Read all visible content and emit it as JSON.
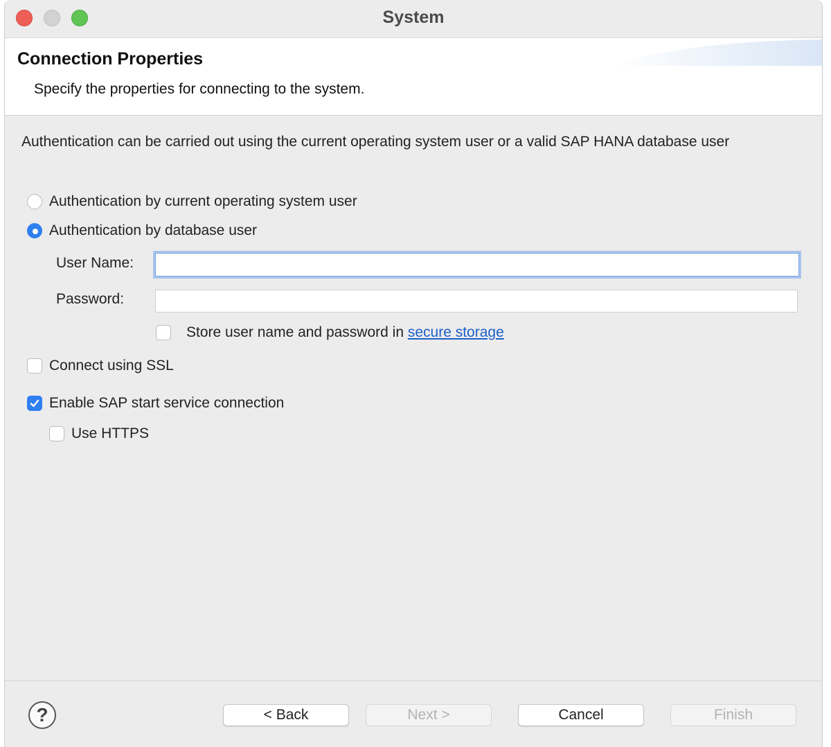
{
  "window": {
    "title": "System"
  },
  "header": {
    "title": "Connection Properties",
    "description": "Specify the properties for connecting to the system."
  },
  "intro": "Authentication can be carried out using the current operating system user or a valid SAP HANA database user",
  "auth_options": [
    {
      "label": "Authentication by current operating system user",
      "selected": false
    },
    {
      "label": "Authentication by database user",
      "selected": true
    }
  ],
  "form": {
    "username_label": "User Name:",
    "username_value": "",
    "password_label": "Password:",
    "password_value": "",
    "store_prefix": "Store user name and password in ",
    "store_link": "secure storage",
    "store_checked": false
  },
  "ssl": {
    "label": "Connect using SSL",
    "checked": false
  },
  "sap_start": {
    "label": "Enable SAP start service connection",
    "checked": true
  },
  "https": {
    "label": "Use HTTPS",
    "checked": false
  },
  "buttons": {
    "help": "?",
    "back": "< Back",
    "next": "Next >",
    "cancel": "Cancel",
    "finish": "Finish"
  },
  "colors": {
    "accent": "#2f7ff0",
    "link": "#1d5fc9"
  }
}
